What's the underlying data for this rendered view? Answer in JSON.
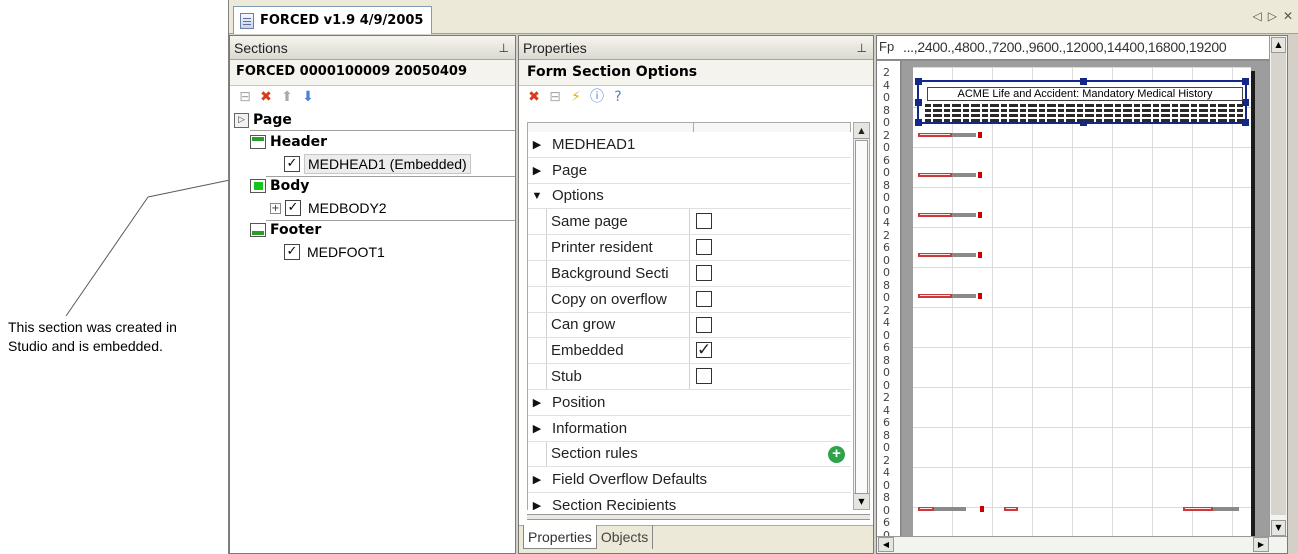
{
  "callout": {
    "text": "This section was created in Studio and is embedded."
  },
  "document_tab": {
    "title": "FORCED v1.9 4/9/2005"
  },
  "sections_panel": {
    "title": "Sections",
    "form_name": "FORCED  0000100009  20050409",
    "groups": [
      {
        "label": "Page"
      },
      {
        "label": "Header",
        "items": [
          {
            "label": "MEDHEAD1 (Embedded)",
            "checked": true
          }
        ]
      },
      {
        "label": "Body",
        "items": [
          {
            "label": "MEDBODY2",
            "checked": true
          }
        ]
      },
      {
        "label": "Footer",
        "items": [
          {
            "label": "MEDFOOT1",
            "checked": true
          }
        ]
      }
    ]
  },
  "properties_panel": {
    "title": "Properties",
    "header": "Form Section Options",
    "rows": [
      {
        "label": "MEDHEAD1",
        "type": "category",
        "arrow": "▶"
      },
      {
        "label": "Page",
        "type": "category",
        "arrow": "▶"
      },
      {
        "label": "Options",
        "type": "category",
        "arrow": "▼"
      },
      {
        "label": "Same page",
        "type": "option",
        "checked": false
      },
      {
        "label": "Printer resident",
        "type": "option",
        "checked": false
      },
      {
        "label": "Background Secti",
        "type": "option",
        "checked": false
      },
      {
        "label": "Copy on overflow",
        "type": "option",
        "checked": false
      },
      {
        "label": "Can grow",
        "type": "option",
        "checked": false
      },
      {
        "label": "Embedded",
        "type": "option",
        "checked": true
      },
      {
        "label": "Stub",
        "type": "option",
        "checked": false
      },
      {
        "label": "Position",
        "type": "category",
        "arrow": "▶"
      },
      {
        "label": "Information",
        "type": "category",
        "arrow": "▶"
      },
      {
        "label": "Section rules",
        "type": "rules"
      },
      {
        "label": "Field Overflow Defaults",
        "type": "category",
        "arrow": "▶"
      },
      {
        "label": "Section Recipients",
        "type": "category",
        "arrow": "▶"
      }
    ],
    "tabs": [
      "Properties",
      "Objects"
    ]
  },
  "preview_panel": {
    "ruler_corner": "Fp",
    "ruler_numbers": "...,2400.,4800.,7200.,9600.,12000,14400,16800,19200",
    "left_ruler_numbers": [
      "2",
      "4",
      "0",
      "8",
      "0",
      "2",
      "0",
      "6",
      "0",
      "8",
      "0",
      "0",
      "4",
      "2",
      "6",
      "0",
      "0",
      "8",
      "0",
      "2",
      "4",
      "0",
      "6",
      "8",
      "0",
      "0",
      "2",
      "4",
      "6",
      "8",
      "0",
      "2",
      "4",
      "0",
      "8",
      "0",
      "6",
      "0"
    ],
    "page_header_title": "ACME Life and Accident: Mandatory Medical History"
  },
  "colors": {
    "selection_frame": "#14288a",
    "field_bar": "#c93b3b",
    "callout_line": "#555555"
  }
}
